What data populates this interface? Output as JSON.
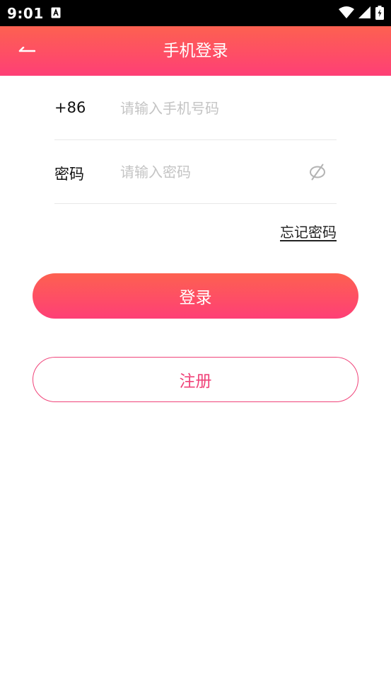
{
  "status_bar": {
    "time": "9:01",
    "notification_icon": "a-icon",
    "icons": [
      "wifi-icon",
      "signal-icon",
      "battery-icon"
    ]
  },
  "app_bar": {
    "title": "手机登录",
    "back_icon": "back-arrow-icon",
    "gradient": [
      "#fd6150",
      "#fe3f76"
    ]
  },
  "form": {
    "phone": {
      "prefix": "+86",
      "placeholder": "请输入手机号码",
      "value": ""
    },
    "password": {
      "label": "密码",
      "placeholder": "请输入密码",
      "value": "",
      "toggle_icon": "eye-off-icon"
    },
    "forgot_password": "忘记密码"
  },
  "actions": {
    "login_label": "登录",
    "register_label": "注册",
    "accent": "#f0447a"
  }
}
